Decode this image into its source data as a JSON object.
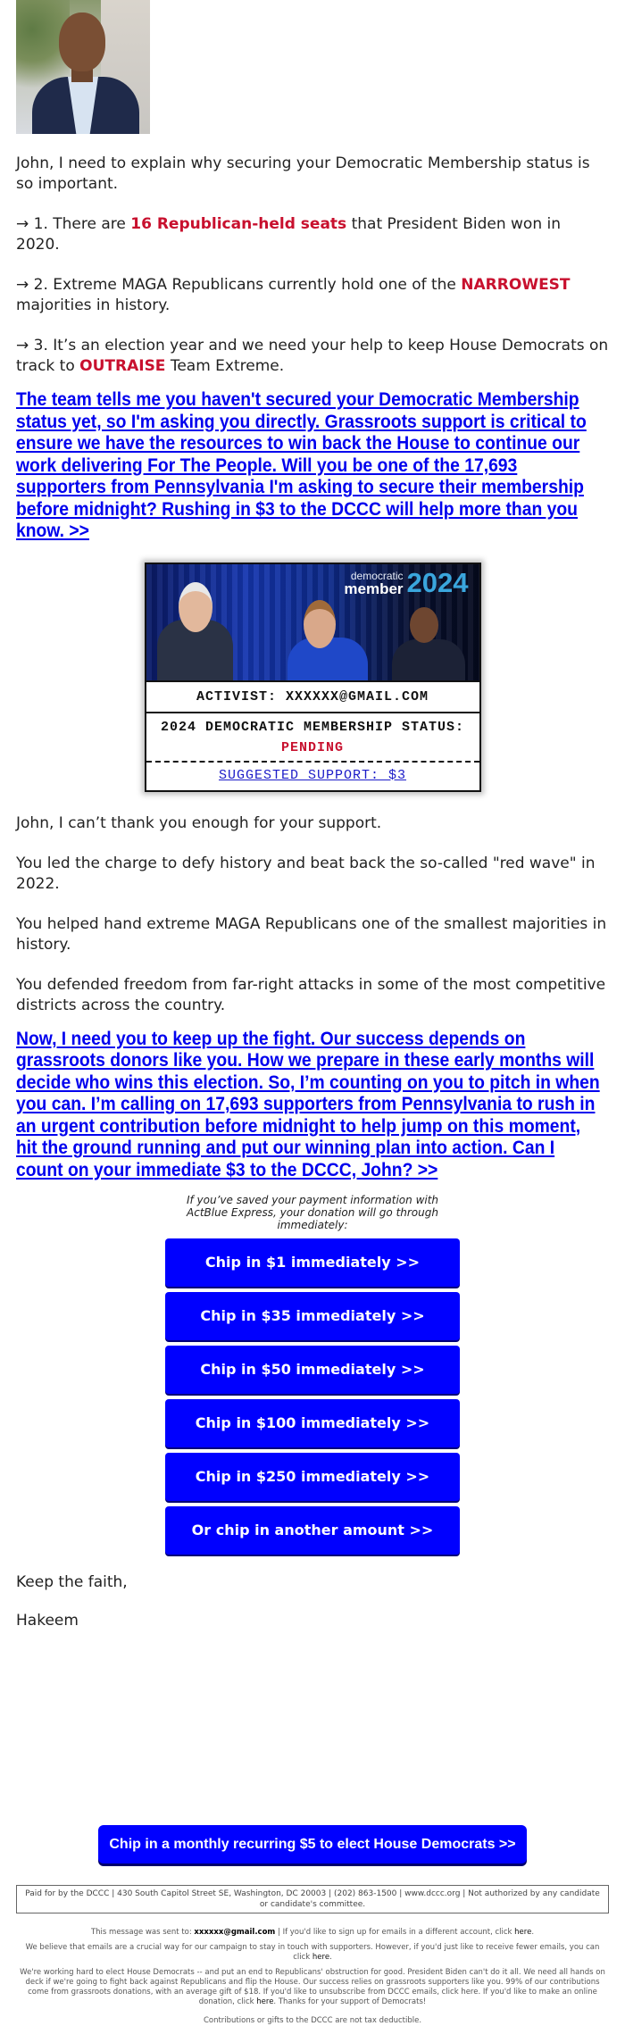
{
  "hero": {
    "photo_alt": "Hakeem Jeffries portrait"
  },
  "intro": "John, I need to explain why securing your Democratic Membership status is so important.",
  "points": [
    {
      "prefix": "→ 1. There are ",
      "highlight": "16 Republican-held seats",
      "suffix": " that President Biden won in 2020."
    },
    {
      "prefix": "→ 2. Extreme MAGA Republicans currently hold one of the ",
      "highlight": "NARROWEST",
      "suffix": " majorities in history."
    },
    {
      "prefix": "→ 3. It’s an election year and we need your help to keep House Democrats on track to ",
      "highlight": "OUTRAISE",
      "suffix": " Team Extreme."
    }
  ],
  "cta_link_1": "The team tells me you haven't secured your Democratic Membership status yet, so I'm asking you directly. Grassroots support is critical to ensure we have the resources to win back the House to continue our work delivering For The People. Will you be one of the 17,693 supporters from Pennsylvania I'm asking to secure their membership before midnight? Rushing in $3 to the DCCC will help more than you know. >>",
  "card": {
    "brand_small": "democratic",
    "brand_member": "member",
    "brand_year": "2024",
    "activist": "ACTIVIST: XXXXXX@GMAIL.COM",
    "status_label": "2024 DEMOCRATIC MEMBERSHIP STATUS:",
    "status_value": "PENDING",
    "suggested": "SUGGESTED SUPPORT: $3"
  },
  "paragraphs": [
    "John, I can’t thank you enough for your support.",
    "You led the charge to defy history and beat back the so-called \"red wave\" in 2022.",
    "You helped hand extreme MAGA Republicans one of the smallest majorities in history.",
    "You defended freedom from far-right attacks in some of the most competitive districts across the country."
  ],
  "cta_link_2": "Now, I need you to keep up the fight. Our success depends on grassroots donors like you. How we prepare in these early months will decide who wins this election. So, I’m counting on you to pitch in when you can. I’m calling on 17,693 supporters from Pennsylvania to rush in an urgent contribution before midnight to help jump on this moment, hit the ground running and put our winning plan into action. Can I count on your immediate $3 to the DCCC, John? >>",
  "actblue_note": "If you’ve saved your payment information with ActBlue Express, your donation will go through immediately:",
  "donate_buttons": [
    "Chip in $1 immediately >>",
    "Chip in $35 immediately >>",
    "Chip in $50 immediately >>",
    "Chip in $100 immediately >>",
    "Chip in $250 immediately >>",
    "Or chip in another amount >>"
  ],
  "signoff": "Keep the faith,",
  "signature": "Hakeem",
  "monthly_button": "Chip in a monthly recurring $5 to elect House Democrats >>",
  "footer": {
    "paid_for": "Paid for by the DCCC | 430 South Capitol Street SE, Washington, DC 20003 | (202) 863-1500 | www.dccc.org | Not authorized by any candidate or candidate's committee.",
    "sent_to_prefix": "This message was sent to: ",
    "sent_to_email": "xxxxxx@gmail.com",
    "sent_to_suffix": " | If you'd like to sign up for emails in a different account, click ",
    "here": "here",
    "period": ".",
    "emails_line": "We believe that emails are a crucial way for our campaign to stay in touch with supporters. However, if you'd just like to receive fewer emails, you can click ",
    "working_line": "We're working hard to elect House Democrats -- and put an end to Republicans' obstruction for good. President Biden can't do it all. We need all hands on deck if we're going to fight back against Republicans and flip the House. Our success relies on grassroots supporters like you. 99% of our contributions come from grassroots donations, with an average gift of $18. If you'd like to unsubscribe from DCCC emails, click here. If you'd like to make an online donation, click ",
    "working_suffix": ". Thanks for your support of Democrats!",
    "tax_line": "Contributions or gifts to the DCCC are not tax deductible."
  },
  "colors": {
    "link_blue": "#0000ee",
    "button_blue": "#0000ff",
    "accent_red": "#c8102e",
    "brand_year_blue": "#3aa6dd"
  }
}
